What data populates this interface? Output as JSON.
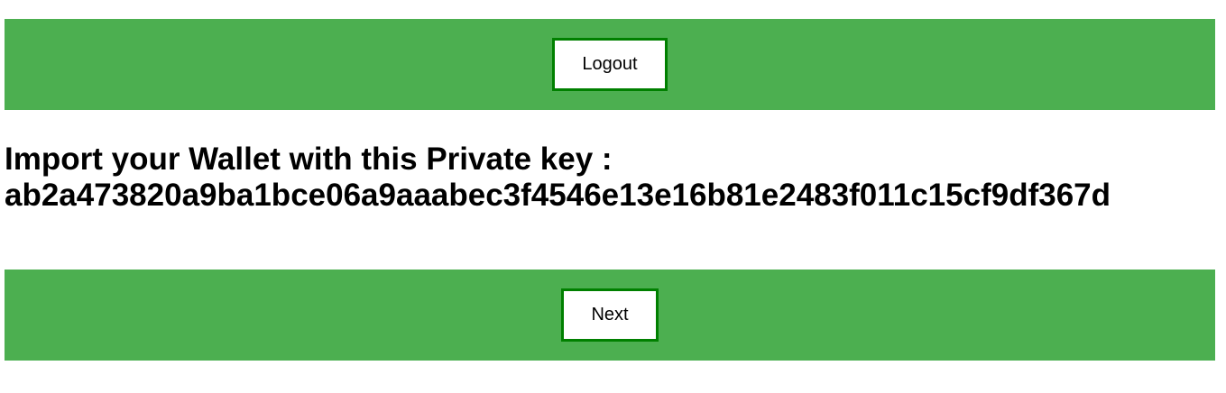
{
  "header": {
    "logout_label": "Logout"
  },
  "main": {
    "heading_prefix": "Import your Wallet with this Private key :",
    "private_key": "ab2a473820a9ba1bce06a9aaabec3f4546e13e16b81e2483f011c15cf9df367d"
  },
  "footer": {
    "next_label": "Next"
  },
  "colors": {
    "bar_background": "#4caf50",
    "button_border": "#008000",
    "button_background": "#ffffff"
  }
}
